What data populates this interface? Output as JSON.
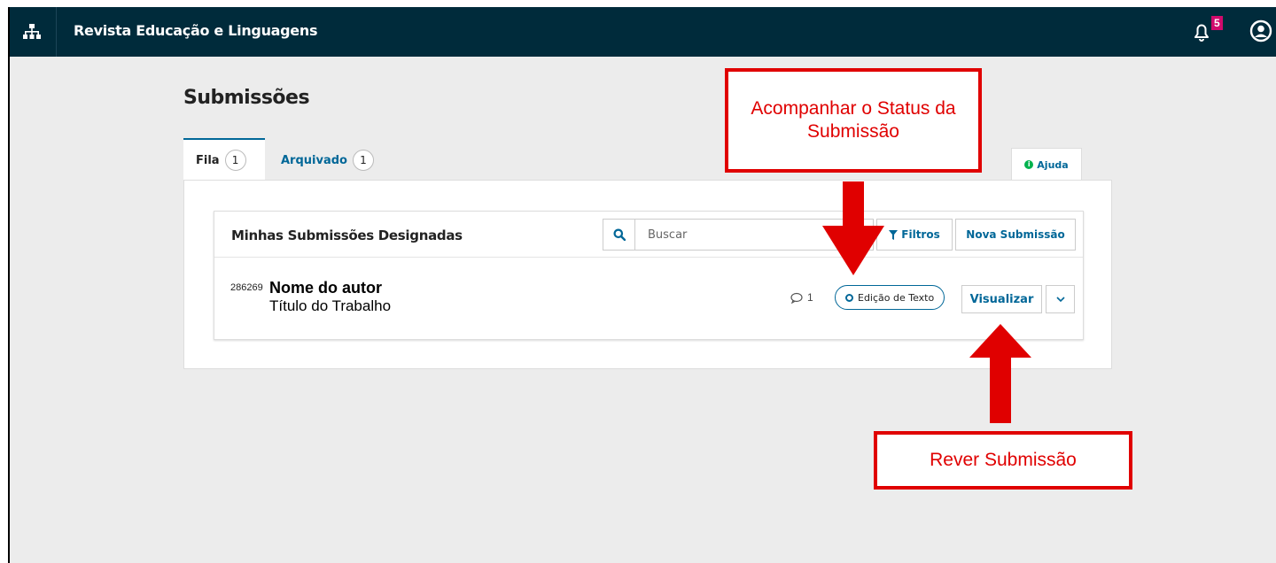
{
  "header": {
    "journal_name": "Revista Educação e Linguagens",
    "notification_count": "5"
  },
  "page": {
    "title": "Submissões"
  },
  "tabs": [
    {
      "label": "Fila",
      "count": "1"
    },
    {
      "label": "Arquivado",
      "count": "1"
    }
  ],
  "help": {
    "label": "Ajuda"
  },
  "list": {
    "title": "Minhas Submissões Designadas",
    "search_placeholder": "Buscar",
    "filters_label": "Filtros",
    "new_submission_label": "Nova Submissão"
  },
  "submission": {
    "id": "286269",
    "author": "Nome do autor",
    "title": "Título do Trabalho",
    "comments": "1",
    "status": "Edição de Texto",
    "view_label": "Visualizar"
  },
  "annotations": {
    "status_callout": "Acompanhar o Status da Submissão",
    "review_callout": "Rever Submissão"
  },
  "colors": {
    "header_bg": "#002b3b",
    "accent": "#006798",
    "callout_red": "#e00000",
    "badge": "#d00a6c"
  },
  "icons": [
    "sitemap-icon",
    "bell-icon",
    "user-circle-icon",
    "search-icon",
    "filter-icon",
    "comment-icon",
    "chevron-down-icon",
    "info-icon"
  ]
}
